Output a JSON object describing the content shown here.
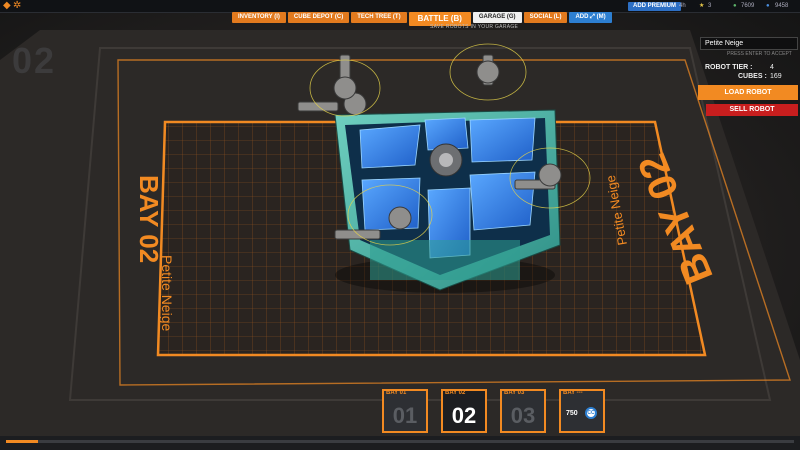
{
  "top_bar": {
    "premium_label": "ADD PREMIUM",
    "premium_value": "4h",
    "tier_value": "3",
    "robits_value": "7609",
    "cosmetic_value": "9458"
  },
  "tabs": [
    {
      "label": "INVENTORY (I)"
    },
    {
      "label": "CUBE DEPOT (C)"
    },
    {
      "label": "TECH TREE (T)"
    },
    {
      "label": "BATTLE (B)"
    },
    {
      "label": "GARAGE (G)"
    },
    {
      "label": "SOCIAL (L)"
    },
    {
      "label": "ADD"
    },
    {
      "label": "(M)"
    }
  ],
  "tab_hint": "SAVE ROBOTS IN YOUR GARAGE",
  "garage_floor": {
    "watermark": "02",
    "bay_label": "BAY 02",
    "robot_name": "Petite Neige"
  },
  "robot_panel": {
    "name_input": "Petite Neige",
    "press_enter": "PRESS ENTER TO ACCEPT",
    "tier_label": "ROBOT TIER :",
    "tier_value": "4",
    "cubes_label": "CUBES :",
    "cubes_value": "169",
    "load_button": "LOAD ROBOT",
    "sell_button": "SELL ROBOT"
  },
  "bays": [
    {
      "label": "BAY 01",
      "number": "01",
      "active": false
    },
    {
      "label": "BAY 02",
      "number": "02",
      "active": true
    },
    {
      "label": "BAY 03",
      "number": "03",
      "active": false
    }
  ],
  "bay_buy": {
    "label": "BAY ---",
    "price": "750",
    "currency_icon": "cosmetic-credit-icon",
    "currency_text": "CC"
  },
  "progress": {
    "fraction": 0.04
  },
  "colors": {
    "accent": "#f28a22",
    "danger": "#c81e1e",
    "blue": "#2d7fd1",
    "grid": "#e9781c"
  }
}
